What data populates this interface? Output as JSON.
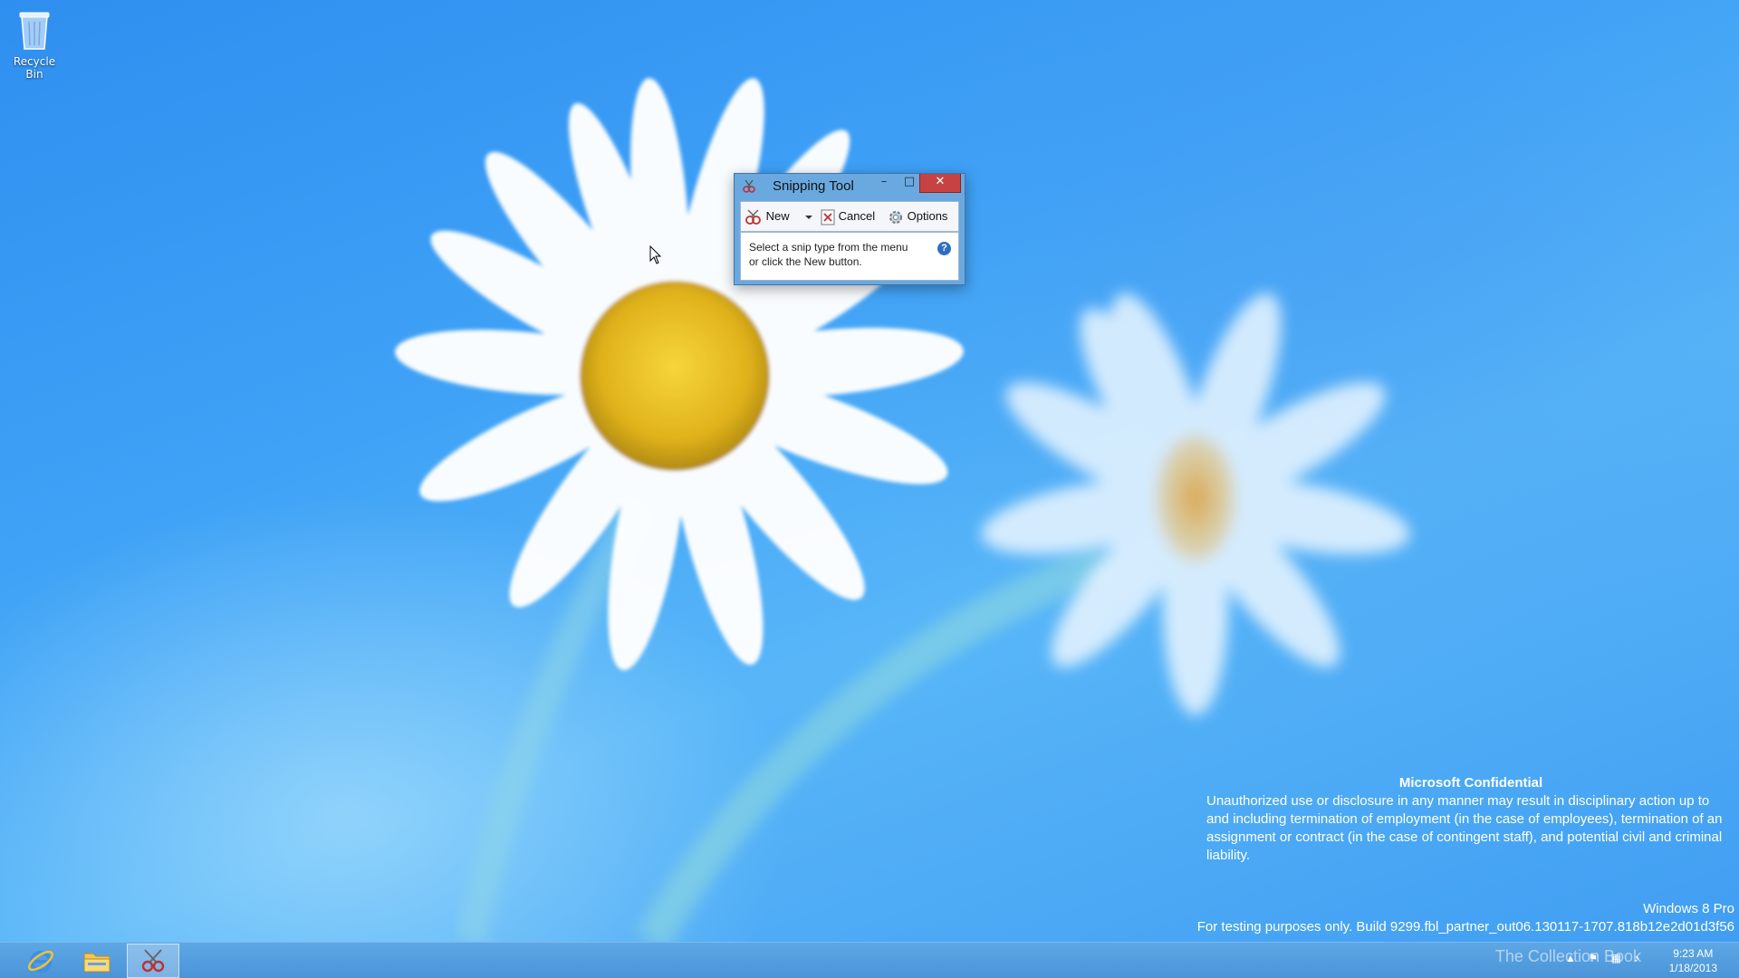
{
  "desktop": {
    "icons": [
      {
        "label": "Recycle Bin",
        "icon": "recycle-bin-icon"
      }
    ]
  },
  "snipping_tool": {
    "title": "Snipping Tool",
    "controls": {
      "minimize": "–",
      "maximize": "□",
      "close": "✕"
    },
    "toolbar": {
      "new_label": "New",
      "cancel_label": "Cancel",
      "options_label": "Options"
    },
    "message_line1": "Select a snip type from the menu",
    "message_line2": "or click the New button.",
    "help_glyph": "?"
  },
  "watermark": {
    "header": "Microsoft Confidential",
    "body": "Unauthorized use or disclosure in any manner may result in disciplinary action up to and including termination of employment (in the case of employees), termination of an assignment or contract (in the case of contingent staff), and potential civil and criminal liability.",
    "edition": "Windows 8 Pro",
    "build": "For testing purposes only. Build 9299.fbl_partner_out06.130117-1707.818b12e2d01d3f56"
  },
  "taskbar": {
    "apps": [
      {
        "name": "internet-explorer",
        "icon": "internet-explorer-icon"
      },
      {
        "name": "file-explorer",
        "icon": "folder-icon"
      },
      {
        "name": "snipping-tool",
        "icon": "scissors-icon",
        "active": true
      }
    ],
    "clock_time": "9:23 AM",
    "clock_date": "1/18/2013",
    "overlay_text": "The Collection Book"
  },
  "colors": {
    "accent": "#4a94d8",
    "close_button": "#c74343"
  }
}
